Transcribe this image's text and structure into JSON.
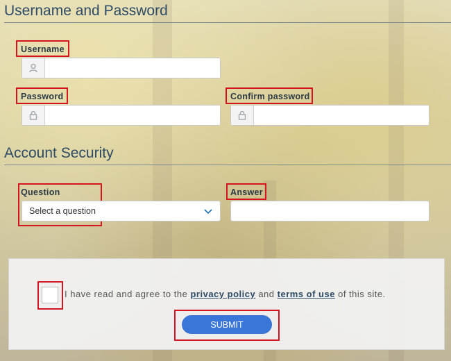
{
  "sections": {
    "credentials_title": "Username and Password",
    "security_title": "Account Security"
  },
  "fields": {
    "username_label": "Username",
    "password_label": "Password",
    "confirm_password_label": "Confirm password",
    "question_label": "Question",
    "answer_label": "Answer",
    "question_value": "Select a question"
  },
  "agreement": {
    "prefix": "I have read and agree to the",
    "privacy_link": "privacy policy",
    "and": "and",
    "terms_link": "terms of use",
    "suffix": "of this site."
  },
  "submit_label": "SUBMIT",
  "colors": {
    "accent": "#3a76d8",
    "highlight": "#d4141f",
    "heading": "#2d4a66"
  }
}
